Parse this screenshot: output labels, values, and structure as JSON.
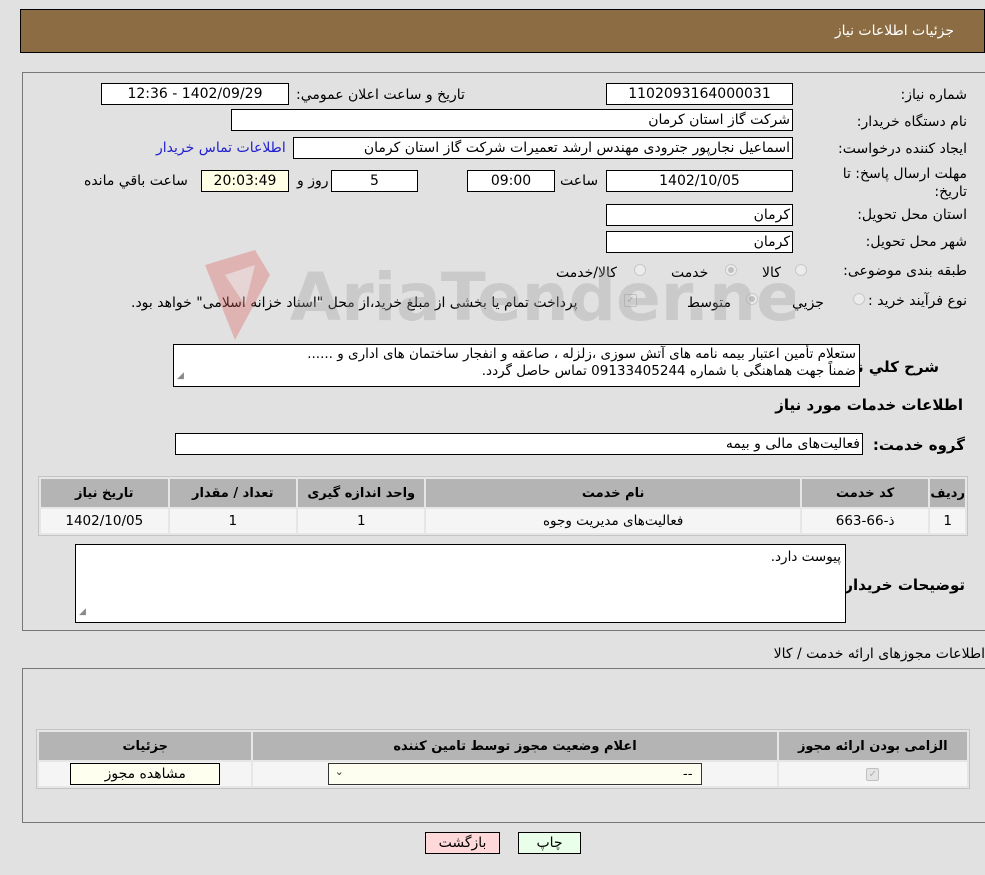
{
  "header": {
    "title": "جزئیات اطلاعات نیاز"
  },
  "form": {
    "need_number_label": "شماره نیاز:",
    "need_number": "1102093164000031",
    "announce_label": "تاریخ و ساعت اعلان عمومي:",
    "announce_value": "1402/09/29 - 12:36",
    "buyer_org_label": "نام دستگاه خريدار:",
    "buyer_org": "شرکت گاز استان کرمان",
    "requester_label": "ایجاد کننده درخواست:",
    "requester": "اسماعیل نجارپور جترودی مهندس ارشد تعمیرات شرکت گاز استان کرمان",
    "contact_link": "اطلاعات تماس خریدار",
    "deadline_label": "مهلت ارسال پاسخ: تا تاریخ:",
    "deadline_date": "1402/10/05",
    "time_label": "ساعت",
    "deadline_time": "09:00",
    "days_value": "5",
    "days_label": "روز و",
    "remaining_time": "20:03:49",
    "remaining_label": "ساعت باقي مانده",
    "province_label": "استان محل تحویل:",
    "province": "کرمان",
    "city_label": "شهر محل تحویل:",
    "city": "کرمان",
    "category_label": "طبقه بندی موضوعی:",
    "category_options": [
      "کالا",
      "خدمت",
      "کالا/خدمت"
    ],
    "category_selected": "خدمت",
    "process_label": "نوع فرآیند خرید :",
    "process_options": [
      "جزيي",
      "متوسط"
    ],
    "process_selected": "متوسط",
    "treasury_note": "پرداخت تمام یا بخشی از مبلغ خرید،از محل \"اسناد خزانه اسلامی\" خواهد بود.",
    "treasury_checked": true
  },
  "description": {
    "label": "شرح کلي نياز:",
    "line1": "ستعلام تأمین اعتبار بیمه نامه های آتش سوزی ،زلزله ، صاعقه و انفجار ساختمان های اداری و ......",
    "line2": "ضمناً جهت  هماهنگی با شماره 09133405244 تماس حاصل گردد."
  },
  "services": {
    "section_title": "اطلاعات خدمات مورد نیاز",
    "group_label": "گروه خدمت:",
    "group_value": "فعالیت‌های مالی و بیمه",
    "columns": [
      "ردیف",
      "کد خدمت",
      "نام خدمت",
      "واحد اندازه گیری",
      "تعداد / مقدار",
      "تاریخ نیاز"
    ],
    "rows": [
      [
        "1",
        "ذ-66-663",
        "فعالیت‌های مدیریت وجوه",
        "1",
        "1",
        "1402/10/05"
      ]
    ]
  },
  "buyer_notes": {
    "label": "توضیحات خریدار:",
    "value": "پیوست دارد."
  },
  "permits": {
    "section_title": "اطلاعات مجوزهای ارائه خدمت / کالا",
    "columns": [
      "الزامی بودن ارائه مجوز",
      "اعلام وضعیت مجوز توسط تامین کننده",
      "جزئیات"
    ],
    "row": {
      "required_checked": true,
      "status_value": "--",
      "details_button": "مشاهده مجوز"
    }
  },
  "buttons": {
    "print": "چاپ",
    "back": "بازگشت"
  },
  "colors": {
    "header_bg": "#8b6c43",
    "back_bg": "#ffd9d9",
    "print_bg": "#eaffea",
    "highlight_field": "#ffffe6"
  },
  "watermark": {
    "text": "AriaTender.neT"
  }
}
